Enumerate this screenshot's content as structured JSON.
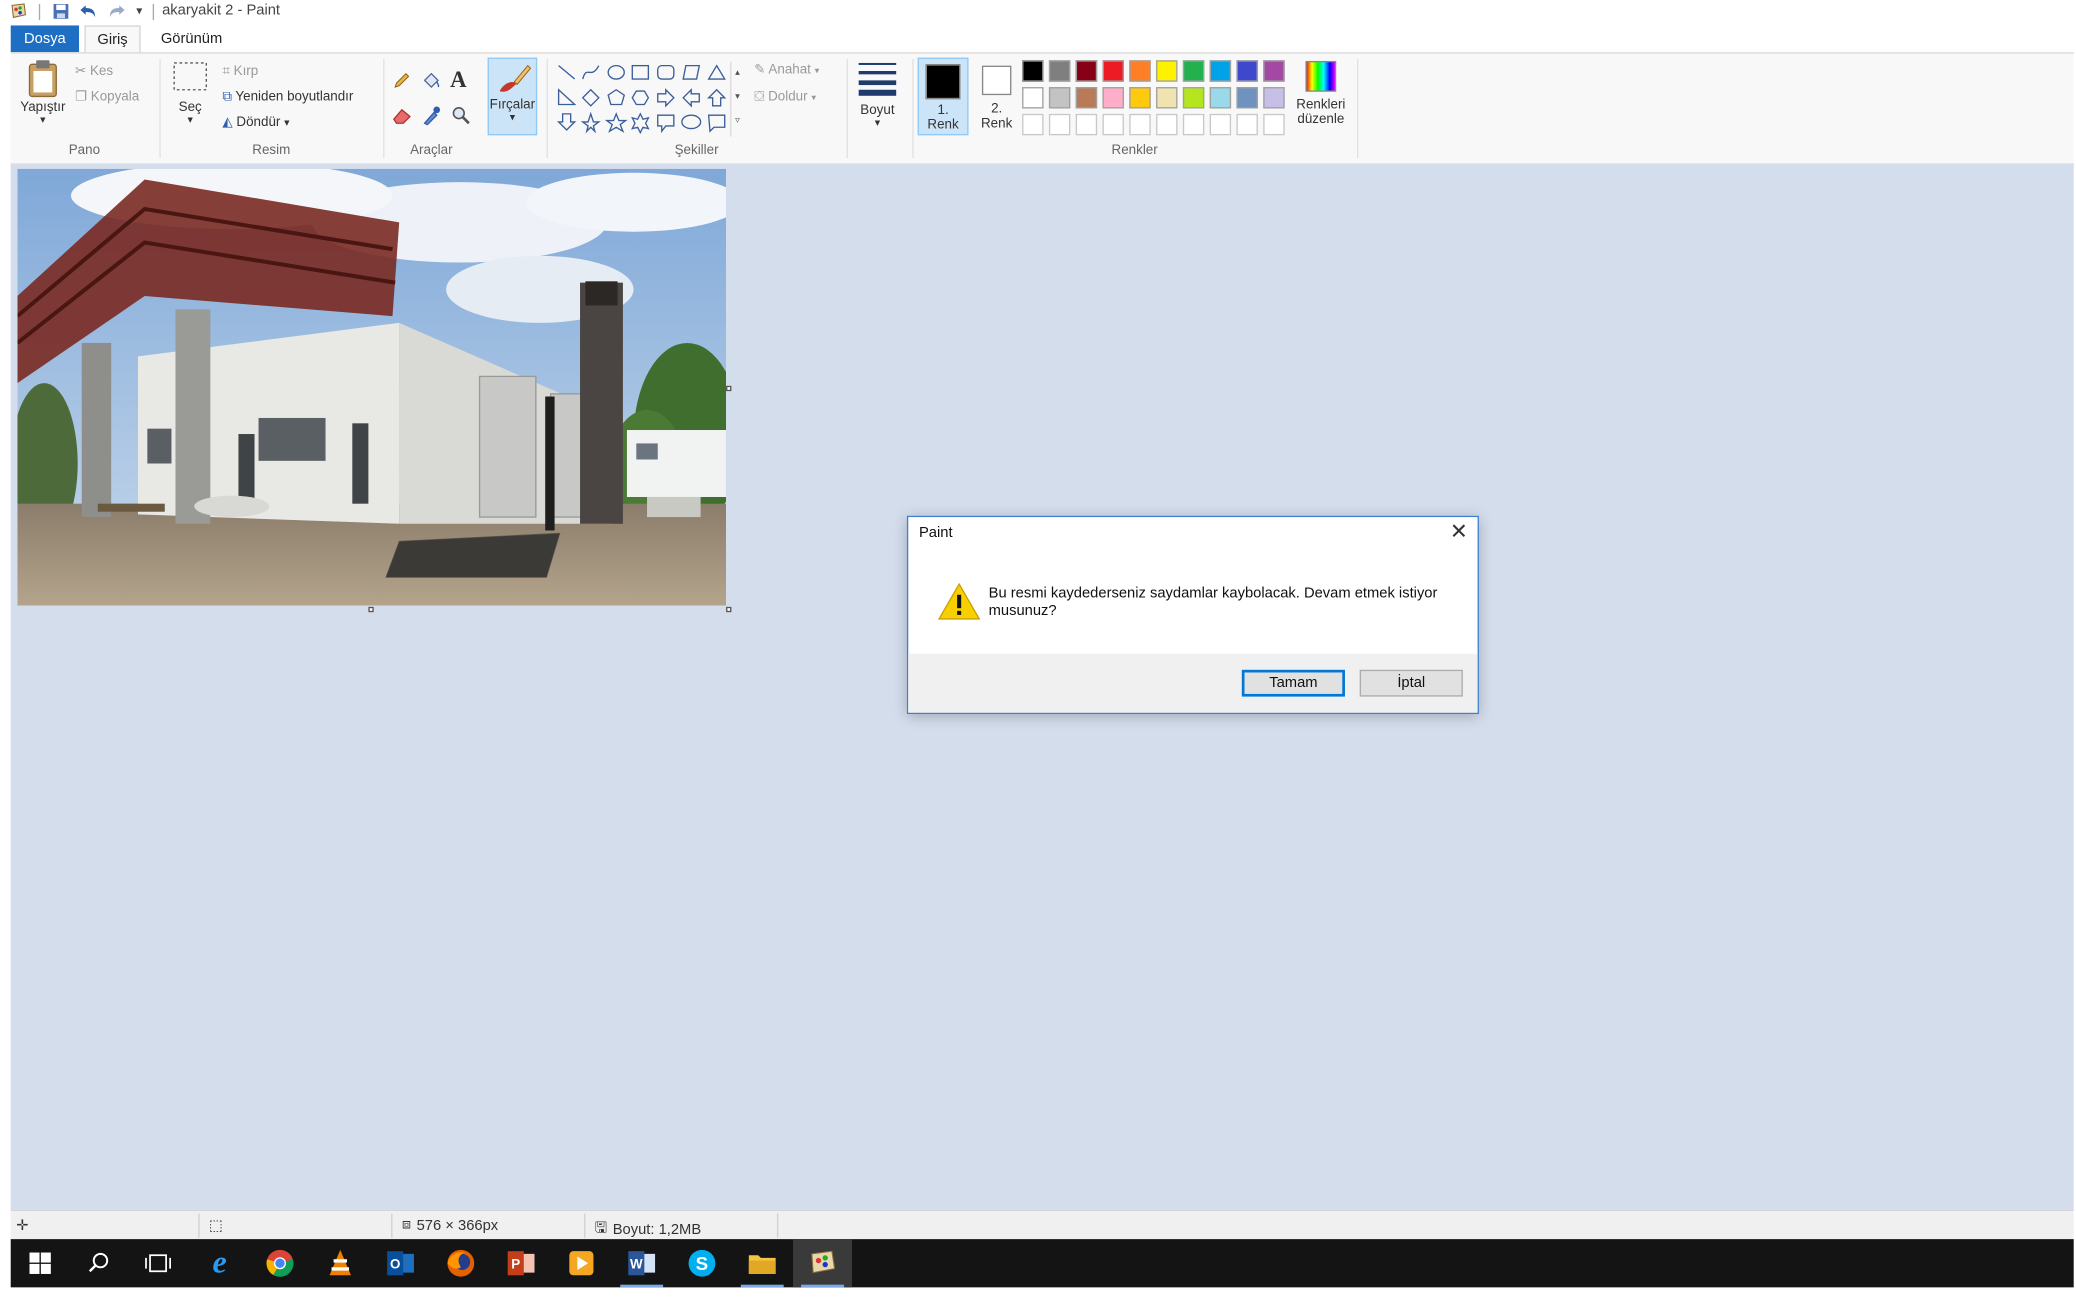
{
  "window": {
    "title": "akaryakit 2 - Paint"
  },
  "tabs": [
    {
      "label": "Dosya"
    },
    {
      "label": "Giriş"
    },
    {
      "label": "Görünüm"
    }
  ],
  "ribbon": {
    "clipboard": {
      "paste_label": "Yapıştır",
      "cut_label": "Kes",
      "copy_label": "Kopyala",
      "group_label": "Pano"
    },
    "image": {
      "select_label": "Seç",
      "crop_label": "Kırp",
      "resize_label": "Yeniden boyutlandır",
      "rotate_label": "Döndür",
      "group_label": "Resim"
    },
    "tools": {
      "group_label": "Araçlar"
    },
    "brushes": {
      "label": "Fırçalar"
    },
    "shapes": {
      "outline_label": "Anahat",
      "fill_label": "Doldur",
      "group_label": "Şekiller"
    },
    "size": {
      "label": "Boyut"
    },
    "colors": {
      "color1_num": "1.",
      "color1_word": "Renk",
      "color2_num": "2.",
      "color2_word": "Renk",
      "edit_line1": "Renkleri",
      "edit_line2": "düzenle",
      "group_label": "Renkler",
      "color1_value": "#000000",
      "color2_value": "#ffffff",
      "palette_row1": [
        "#000000",
        "#7f7f7f",
        "#880015",
        "#ed1c24",
        "#ff7f27",
        "#fff200",
        "#22b14c",
        "#00a2e8",
        "#3f48cc",
        "#a349a4"
      ],
      "palette_row2": [
        "#ffffff",
        "#c3c3c3",
        "#b97a57",
        "#ffaec9",
        "#ffc90e",
        "#efe4b0",
        "#b5e61d",
        "#99d9ea",
        "#7092be",
        "#c8bfe7"
      ],
      "palette_row3": [
        "#ffffff",
        "#ffffff",
        "#ffffff",
        "#ffffff",
        "#ffffff",
        "#ffffff",
        "#ffffff",
        "#ffffff",
        "#ffffff",
        "#ffffff"
      ]
    }
  },
  "status": {
    "dimensions": "576 × 366px",
    "size": "Boyut: 1,2MB"
  },
  "dialog": {
    "title": "Paint",
    "message": "Bu resmi kaydederseniz saydamlar kaybolacak. Devam etmek istiyor musunuz?",
    "ok_label": "Tamam",
    "cancel_label": "İptal",
    "close_glyph": "✕"
  },
  "taskbar": {
    "icons": [
      "windows-start",
      "search",
      "task-view",
      "internet-explorer",
      "chrome",
      "vlc",
      "outlook",
      "firefox",
      "powerpoint",
      "media-player",
      "word",
      "skype",
      "file-explorer",
      "paint"
    ]
  }
}
